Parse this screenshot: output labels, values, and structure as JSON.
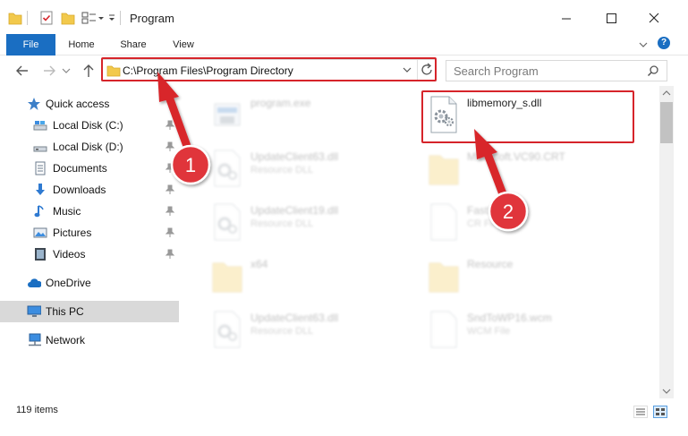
{
  "window": {
    "title": "Program",
    "controls": {
      "minimize": "minimize-icon",
      "maximize": "maximize-icon",
      "close": "close-icon"
    }
  },
  "ribbon": {
    "tabs": [
      {
        "label": "File",
        "active": true
      },
      {
        "label": "Home"
      },
      {
        "label": "Share"
      },
      {
        "label": "View"
      }
    ],
    "help_label": "?"
  },
  "navigation": {
    "address": "C:\\Program Files\\Program Directory",
    "search_placeholder": "Search Program"
  },
  "sidebar": {
    "items": [
      {
        "label": "Quick access",
        "icon": "star-icon"
      },
      {
        "label": "Local Disk (C:)",
        "icon": "drive-icon",
        "pinned": true
      },
      {
        "label": "Local Disk (D:)",
        "icon": "drive-icon",
        "pinned": true
      },
      {
        "label": "Documents",
        "icon": "documents-icon",
        "pinned": true
      },
      {
        "label": "Downloads",
        "icon": "download-icon",
        "pinned": true
      },
      {
        "label": "Music",
        "icon": "music-icon",
        "pinned": true
      },
      {
        "label": "Pictures",
        "icon": "pictures-icon",
        "pinned": true
      },
      {
        "label": "Videos",
        "icon": "videos-icon",
        "pinned": true
      },
      {
        "label": "OneDrive",
        "icon": "cloud-icon"
      },
      {
        "label": "This PC",
        "icon": "computer-icon",
        "selected": true
      },
      {
        "label": "Network",
        "icon": "network-icon"
      }
    ]
  },
  "files": [
    {
      "name": "program.exe",
      "type": "",
      "icon": "exe-icon",
      "faded": true
    },
    {
      "name": "libmemory_s.dll",
      "type": "",
      "icon": "dll-icon",
      "faded": false
    },
    {
      "name": "UpdateClient63.dll",
      "type": "Resource DLL",
      "icon": "dll-icon",
      "faded": true
    },
    {
      "name": "Microsoft.VC90.CRT",
      "type": "",
      "icon": "folder-icon",
      "faded": true
    },
    {
      "name": "UpdateClient19.dll",
      "type": "Resource DLL",
      "icon": "dll-icon",
      "faded": true
    },
    {
      "name": "FastR",
      "type": "CR File",
      "icon": "file-icon",
      "faded": true
    },
    {
      "name": "x64",
      "type": "",
      "icon": "folder-icon",
      "faded": true
    },
    {
      "name": "Resource",
      "type": "",
      "icon": "folder-icon",
      "faded": true
    },
    {
      "name": "UpdateClient63.dll",
      "type": "Resource DLL",
      "icon": "dll-icon",
      "faded": true
    },
    {
      "name": "SndToWP16.wcm",
      "type": "WCM File",
      "icon": "file-icon",
      "faded": true
    }
  ],
  "status": {
    "item_count": "119 items"
  },
  "annotations": [
    {
      "number": "1",
      "target": "address-bar"
    },
    {
      "number": "2",
      "target": "libmemory_s.dll"
    }
  ],
  "colors": {
    "accent": "#1a6ec2",
    "highlight": "#d6242a",
    "badge": "#e0363b",
    "selected": "#d9d9d9"
  }
}
